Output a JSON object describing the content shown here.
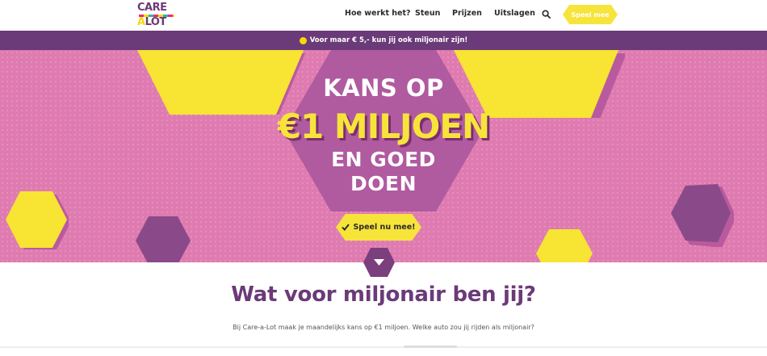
{
  "header": {
    "logo": {
      "line1": "CARE",
      "line2a": "A",
      "line2b": "LOT"
    },
    "nav": [
      "Hoe werkt het?",
      "Steun",
      "Prijzen",
      "Uitslagen"
    ],
    "search_icon": "search-icon",
    "cta_label": "Speel mee"
  },
  "promo": {
    "text": "Voor maar € 5,- kun jij ook miljonair zijn!"
  },
  "hero": {
    "line1": "KANS OP",
    "line2": "€1 MILJOEN",
    "line3": "EN GOED",
    "line4": "DOEN",
    "cta_label": "Speel nu mee!",
    "cta_icon": "check-icon"
  },
  "scroll": {
    "icon": "chevron-down-icon"
  },
  "section": {
    "heading": "Wat voor miljonair ben jij?",
    "text": "Bij Care-a-Lot maak je maandelijks kans op €1 miljoen. Welke auto zou jij rijden als miljonair?"
  },
  "colors": {
    "brand_purple": "#6b3a78",
    "hero_pink": "#df7bb0",
    "accent_yellow": "#f7e43a",
    "hex_purple": "#8a4a8a",
    "hex_mid": "#b05aa0"
  }
}
